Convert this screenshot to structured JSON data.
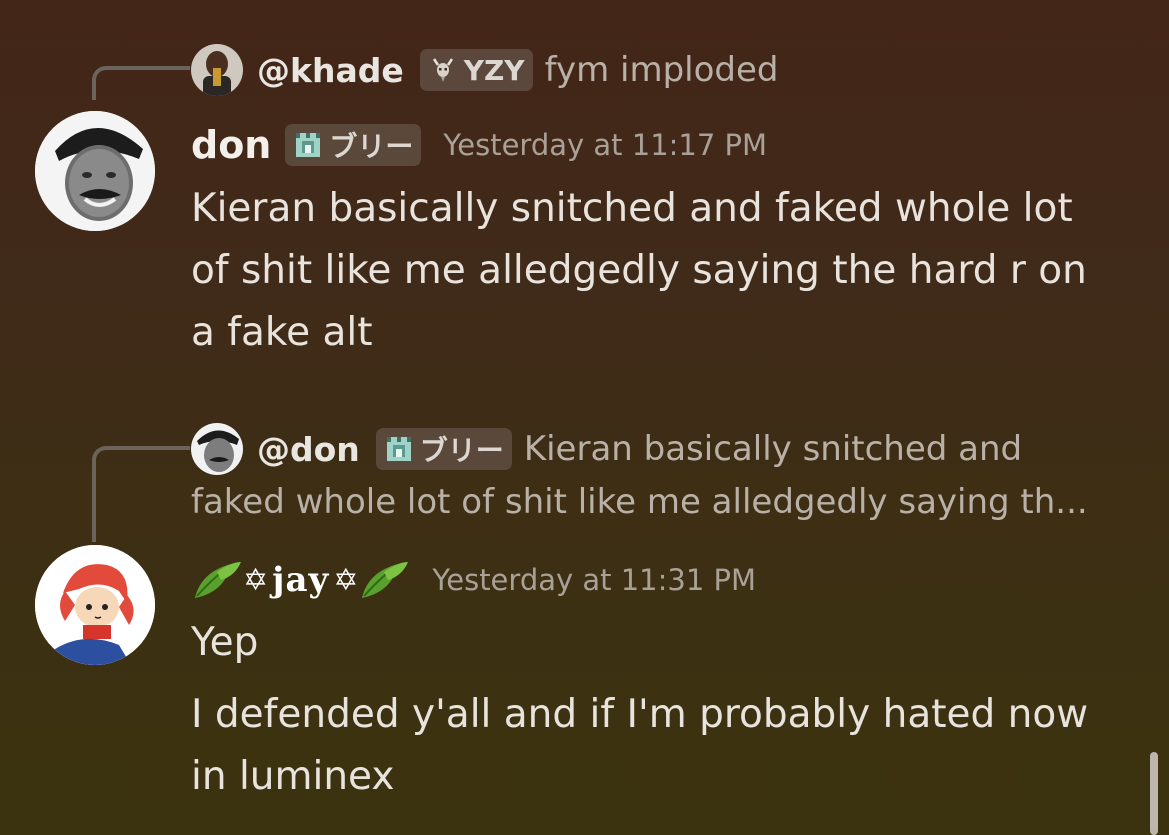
{
  "messages": [
    {
      "reply": {
        "author": "@khade",
        "tag": "YZY",
        "tag_icon": "goat-icon",
        "content": "fym imploded"
      },
      "author": "don",
      "tag": "ブリー",
      "tag_icon": "castle-icon",
      "timestamp": "Yesterday at 11:17 PM",
      "lines": [
        "Kieran basically snitched and faked whole lot",
        "of shit like me alledgedly saying the hard r on",
        "a fake alt"
      ]
    },
    {
      "reply": {
        "author": "@don",
        "tag": "ブリー",
        "tag_icon": "castle-icon",
        "content_line1": "Kieran basically snitched and",
        "content_line2": "faked whole lot of shit like me alledgedly saying th..."
      },
      "author": "jay",
      "author_decor": "✡",
      "timestamp": "Yesterday at 11:31 PM",
      "lines": [
        "Yep",
        "I defended y'all and if I'm probably hated now",
        "in luminex"
      ]
    }
  ]
}
